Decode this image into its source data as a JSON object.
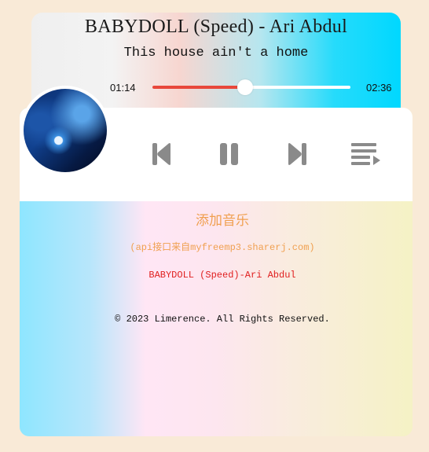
{
  "player": {
    "title": "BABYDOLL (Speed) - Ari Abdul",
    "lyric": "This house ain't a home",
    "current_time": "01:14",
    "duration": "02:36",
    "progress_fraction": 0.47
  },
  "controls": {
    "previous_icon": "skip-previous-icon",
    "pause_icon": "pause-icon",
    "next_icon": "skip-next-icon",
    "playlist_icon": "playlist-icon"
  },
  "panel": {
    "add_music": "添加音乐",
    "api_note": "(api接口来自myfreemp3.sharerj.com)",
    "now_playing": "BABYDOLL (Speed)-Ari Abdul",
    "copyright": "© 2023 Limerence. All Rights Reserved."
  },
  "colors": {
    "accent_progress": "#e8473b",
    "add_music_text": "#f0a050",
    "now_playing_text": "#e02020",
    "control_icon": "#8a8a8a"
  }
}
